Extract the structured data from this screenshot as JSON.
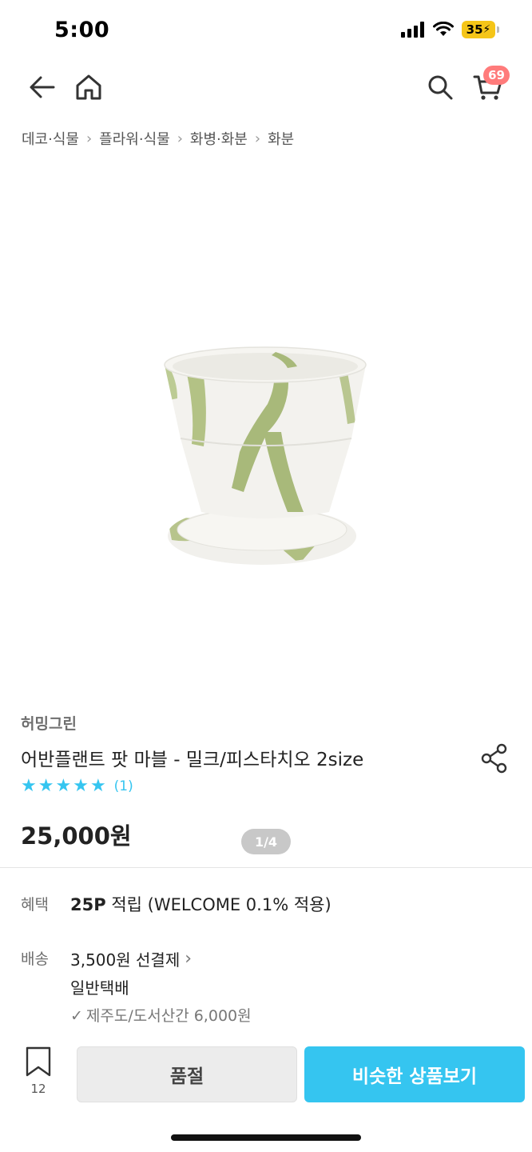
{
  "status_bar": {
    "time": "5:00",
    "battery": "35"
  },
  "nav": {
    "cart_count": "69"
  },
  "breadcrumb": [
    "데코·식물",
    "플라워·식물",
    "화병·화분",
    "화분"
  ],
  "product": {
    "image_counter": "1/4",
    "brand": "허밍그린",
    "name": "어반플랜트 팟 마블 - 밀크/피스타치오 2size",
    "rating_stars": 5,
    "review_count": "(1)",
    "price": "25,000원"
  },
  "benefit": {
    "label": "혜택",
    "points": "25P",
    "text": "적립 (WELCOME 0.1% 적용)"
  },
  "shipping": {
    "label": "배송",
    "fee": "3,500원 선결제",
    "type": "일반택배",
    "extra": "제주도/도서산간 6,000원"
  },
  "bottom_bar": {
    "bookmark_count": "12",
    "soldout_label": "품절",
    "similar_label": "비슷한 상품보기"
  },
  "colors": {
    "accent": "#35c5f0",
    "badge": "#ff7b7b",
    "pot_green": "#a8b97a"
  }
}
